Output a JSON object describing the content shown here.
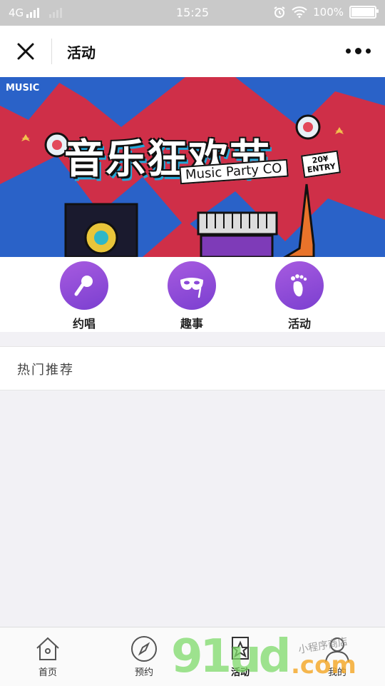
{
  "status_bar": {
    "network": "4G",
    "time": "15:25",
    "battery": "100%",
    "battery_level": 1.0
  },
  "navbar": {
    "title": "活动",
    "close_icon": "close-icon",
    "more_icon": "more-dots-icon"
  },
  "banner": {
    "brand": "MUSIC",
    "title": "音乐狂欢节",
    "subtitle": "Music Party CO",
    "badge_top": "20¥",
    "badge_bottom": "ENTRY"
  },
  "categories": [
    {
      "label": "约唱",
      "icon": "microphone-icon"
    },
    {
      "label": "趣事",
      "icon": "mask-icon"
    },
    {
      "label": "活动",
      "icon": "footprint-icon"
    }
  ],
  "hot_section": {
    "title": "热门推荐"
  },
  "tabbar": {
    "items": [
      {
        "label": "首页",
        "icon": "home-icon"
      },
      {
        "label": "预约",
        "icon": "compass-icon"
      },
      {
        "label": "活动",
        "icon": "star-icon",
        "active": true
      },
      {
        "label": "我的",
        "icon": "user-icon"
      }
    ]
  },
  "watermark": {
    "text": "91ud",
    "suffix": ".com",
    "small": "小程序商店"
  },
  "colors": {
    "accent_purple": "#8a49d8",
    "banner_red": "#cf2f48",
    "banner_blue": "#2a62c8"
  }
}
